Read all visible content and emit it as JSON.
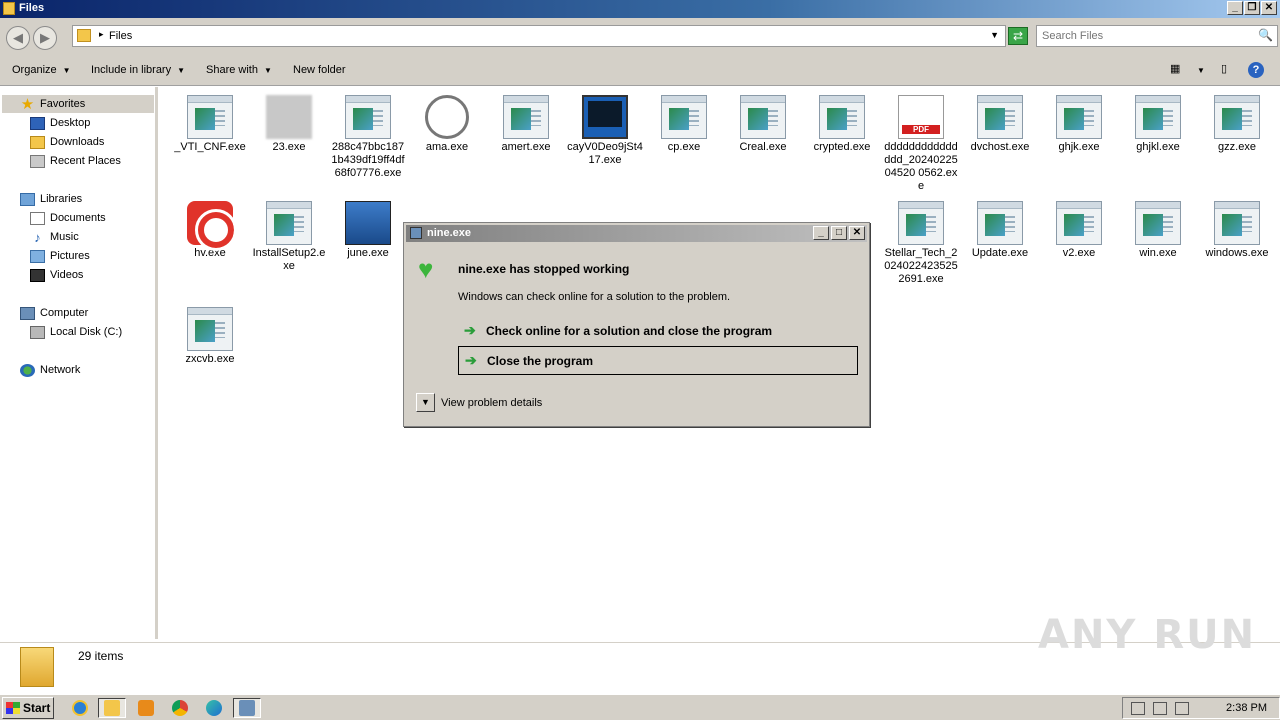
{
  "window": {
    "title": "Files"
  },
  "address": {
    "crumb": "Files",
    "search_placeholder": "Search Files"
  },
  "toolbar": {
    "organize": "Organize",
    "include": "Include in library",
    "share": "Share with",
    "new_folder": "New folder"
  },
  "nav": {
    "favorites": "Favorites",
    "desktop": "Desktop",
    "downloads": "Downloads",
    "recent": "Recent Places",
    "libraries": "Libraries",
    "documents": "Documents",
    "music": "Music",
    "pictures": "Pictures",
    "videos": "Videos",
    "computer": "Computer",
    "local_disk": "Local Disk (C:)",
    "network": "Network"
  },
  "files": [
    {
      "name": "_VTI_CNF.exe",
      "icon": "exe-icon"
    },
    {
      "name": "23.exe",
      "icon": "blurred-icon"
    },
    {
      "name": "288c47bbc1871b439df19ff4df68f07776.exe",
      "icon": "exe-icon"
    },
    {
      "name": "ama.exe",
      "icon": "gauge-icon"
    },
    {
      "name": "amert.exe",
      "icon": "exe-icon"
    },
    {
      "name": "cayV0Deo9jSt417.exe",
      "icon": "terminal-icon"
    },
    {
      "name": "cp.exe",
      "icon": "exe-icon"
    },
    {
      "name": "Creal.exe",
      "icon": "exe-icon"
    },
    {
      "name": "crypted.exe",
      "icon": "exe-icon"
    },
    {
      "name": "ddddddddddddddd_2024022504520 0562.exe",
      "icon": "pdf-icon"
    },
    {
      "name": "dvchost.exe",
      "icon": "exe-icon"
    },
    {
      "name": "ghjk.exe",
      "icon": "exe-icon"
    },
    {
      "name": "ghjkl.exe",
      "icon": "exe-icon"
    },
    {
      "name": "gzz.exe",
      "icon": "exe-icon"
    },
    {
      "name": "hv.exe",
      "icon": "recorder-icon"
    },
    {
      "name": "InstallSetup2.exe",
      "icon": "exe-icon"
    },
    {
      "name": "june.exe",
      "icon": "installer-icon"
    },
    {
      "name": "Stellar_Tech_20240224235252691.exe",
      "icon": "exe-icon"
    },
    {
      "name": "Update.exe",
      "icon": "exe-icon"
    },
    {
      "name": "v2.exe",
      "icon": "exe-icon"
    },
    {
      "name": "win.exe",
      "icon": "exe-icon"
    },
    {
      "name": "windows.exe",
      "icon": "exe-icon"
    },
    {
      "name": "zxcvb.exe",
      "icon": "exe-icon"
    }
  ],
  "status": {
    "count": "29 items"
  },
  "watermark": "ANY RUN",
  "dialog": {
    "title": "nine.exe",
    "heading": "nine.exe has stopped working",
    "subtext": "Windows can check online for a solution to the problem.",
    "option1": "Check online for a solution and close the program",
    "option2": "Close the program",
    "details": "View problem details"
  },
  "taskbar": {
    "start": "Start",
    "clock": "2:38 PM"
  }
}
